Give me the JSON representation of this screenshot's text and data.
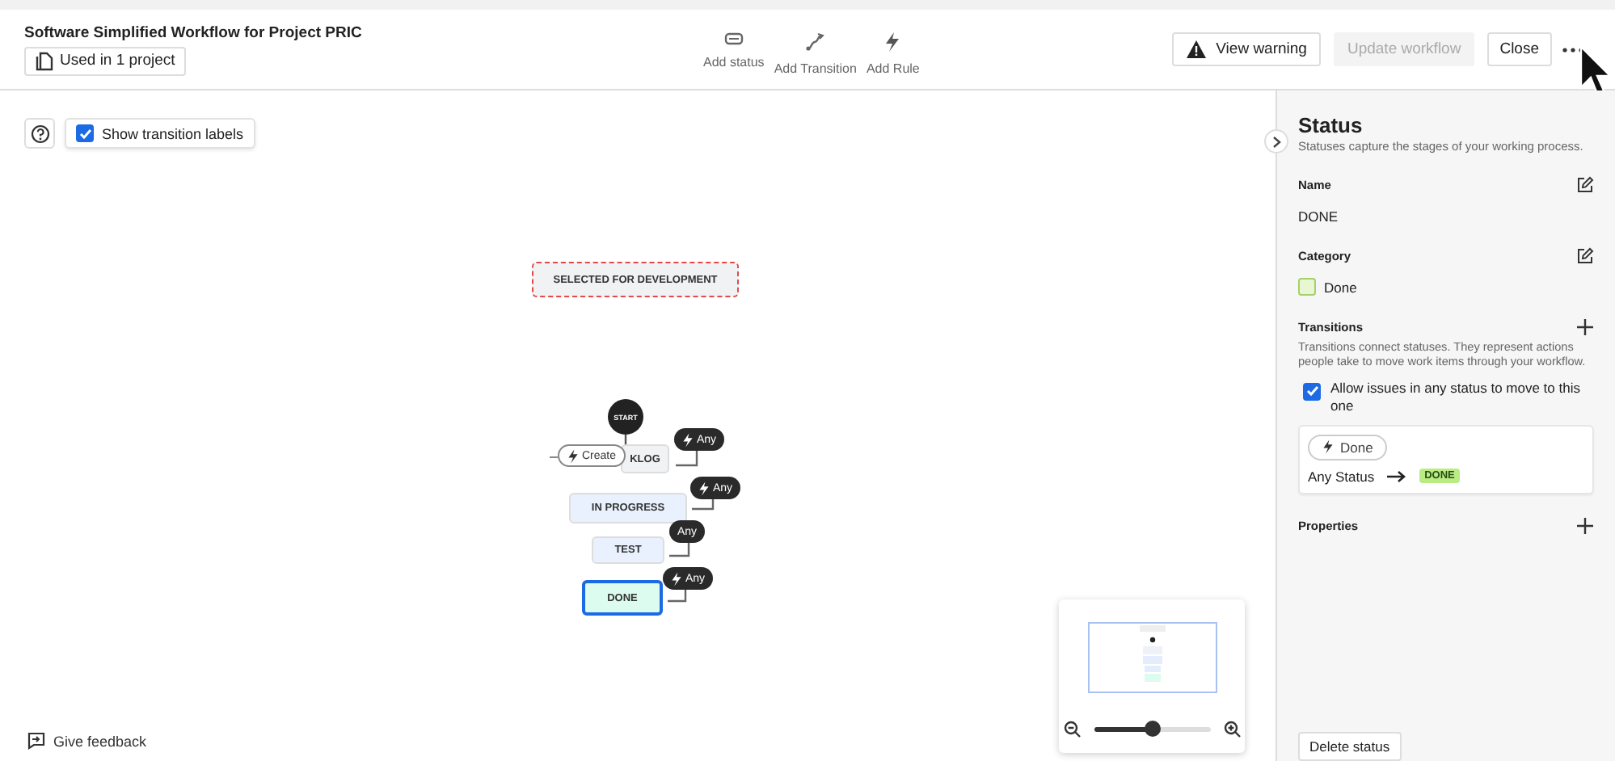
{
  "header": {
    "title": "Software Simplified Workflow for Project PRIC",
    "usage": "Used in 1 project",
    "tools": [
      {
        "kind": "status",
        "label": "Add status"
      },
      {
        "kind": "transition",
        "label": "Add Transition"
      },
      {
        "kind": "rule",
        "label": "Add Rule"
      }
    ],
    "actions": [
      {
        "kind": "warning",
        "label": "View warning",
        "disabled": false
      },
      {
        "kind": "plain",
        "label": "Update workflow",
        "disabled": true
      },
      {
        "kind": "plain",
        "label": "Close",
        "disabled": false
      }
    ]
  },
  "canvas": {
    "show_labels": {
      "label": "Show transition labels",
      "checked": true
    },
    "nodes": [
      {
        "kind": "status",
        "label": "SELECTED FOR DEVELOPMENT",
        "color": "#f1f2f4",
        "warning": true,
        "selected": false
      },
      {
        "kind": "start",
        "label": "START"
      },
      {
        "kind": "status",
        "label": "KLOG",
        "color": "#f1f2f4",
        "warning": false,
        "selected": false
      },
      {
        "kind": "status",
        "label": "IN PROGRESS",
        "color": "#e9f1fe",
        "warning": false,
        "selected": false
      },
      {
        "kind": "status",
        "label": "TEST",
        "color": "#e9f1fe",
        "warning": false,
        "selected": false
      },
      {
        "kind": "status",
        "label": "DONE",
        "color": "#dcfcef",
        "warning": false,
        "selected": true
      }
    ],
    "transitions": [
      {
        "label": "Create",
        "rule": true,
        "kind": "create"
      },
      {
        "label": "Any",
        "rule": true,
        "kind": "any"
      },
      {
        "label": "Any",
        "rule": true,
        "kind": "any"
      },
      {
        "label": "Any",
        "rule": false,
        "kind": "any"
      },
      {
        "label": "Any",
        "rule": true,
        "kind": "any"
      }
    ],
    "feedback": "Give feedback",
    "minimap": {
      "zoom": {
        "level": 0.51
      }
    }
  },
  "panel": {
    "title": "Status",
    "subtitle": "Statuses capture the stages of your working process.",
    "name": {
      "label": "Name",
      "value": "DONE"
    },
    "category": {
      "label": "Category",
      "value": "Done",
      "color": "#e8f6d4"
    },
    "transitions": {
      "label": "Transitions",
      "description": "Transitions connect statuses. They represent actions people take to move work items through your workflow.",
      "allow_any": {
        "label": "Allow issues in any status to move to this one",
        "checked": true
      },
      "card": {
        "name": "Done",
        "from": "Any Status",
        "to": "DONE"
      }
    },
    "properties": {
      "label": "Properties"
    },
    "delete": "Delete status"
  }
}
